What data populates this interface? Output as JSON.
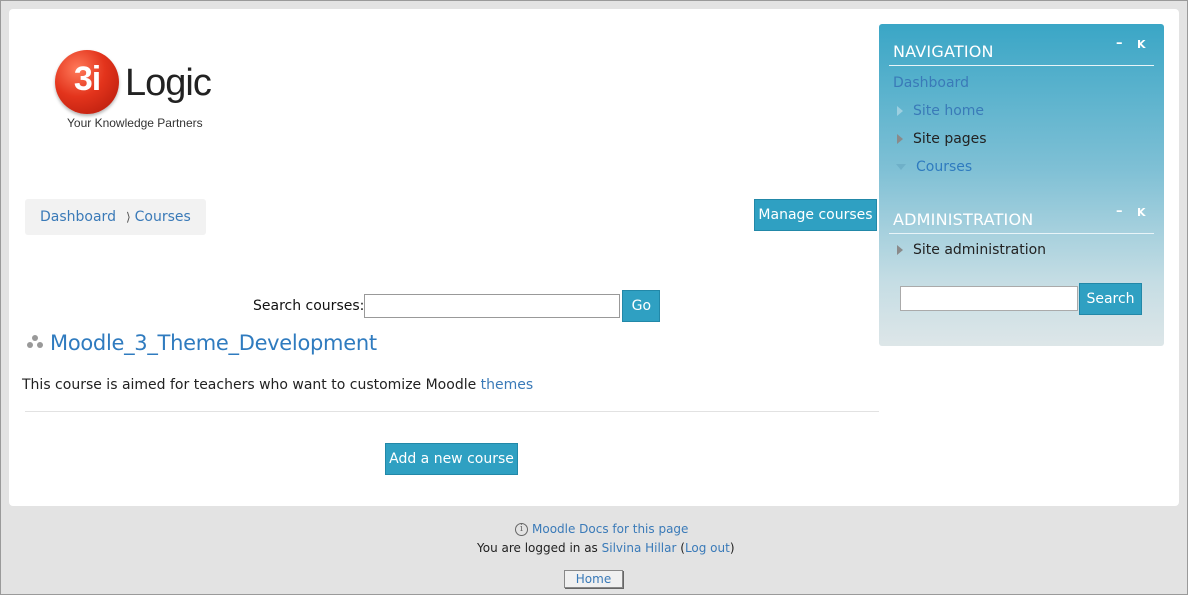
{
  "logo": {
    "mark": "3i",
    "word": "Logic",
    "tagline": "Your Knowledge Partners"
  },
  "breadcrumb": {
    "items": [
      "Dashboard",
      "Courses"
    ],
    "separator": "⟩"
  },
  "buttons": {
    "manage_courses": "Manage courses",
    "add_course": "Add a new course",
    "go": "Go"
  },
  "search": {
    "label": "Search courses:",
    "value": ""
  },
  "course": {
    "title": "Moodle_3_Theme_Development",
    "summary_prefix": "This course is aimed for teachers who want to customize Moodle ",
    "summary_link": "themes"
  },
  "navigation": {
    "title": "NAVIGATION",
    "dashboard": "Dashboard",
    "items": [
      "Site home",
      "Site pages",
      "Courses"
    ]
  },
  "administration": {
    "title": "ADMINISTRATION",
    "item": "Site administration",
    "search_label": "Search"
  },
  "block_controls": {
    "dock": "–",
    "hide": "K"
  },
  "footer": {
    "docs_link": "Moodle Docs for this page",
    "logged_in_prefix": "You are logged in as ",
    "user": "Silvina Hillar",
    "logout": "Log out",
    "home": "Home"
  },
  "colors": {
    "accent": "#2fa0c2",
    "link": "#3a7ab8",
    "logo_red": "#e3341c"
  }
}
